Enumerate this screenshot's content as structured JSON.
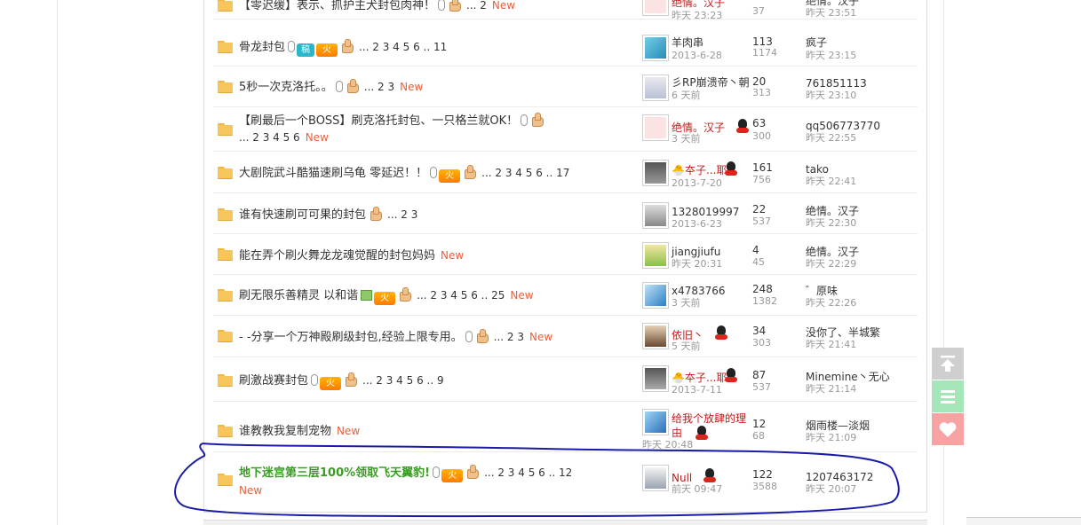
{
  "threads": [
    {
      "title": "【零迟缓】表示、抓护主犬封包肉神！",
      "pages": "... 2",
      "new": "New",
      "author": "绝情。汉子",
      "author_date": "昨天 23:23",
      "replies": "",
      "views": "37",
      "last_user": "绝情。汉子",
      "last_time": "昨天 23:51"
    },
    {
      "title": "骨龙封包",
      "pages": "... 2  3  4  5  6 .. 11",
      "new": "",
      "author": "羊肉串",
      "author_date": "2013-6-28",
      "replies": "113",
      "views": "1174",
      "last_user": "疯子",
      "last_time": "昨天 23:15"
    },
    {
      "title": "5秒一次克洛托。。",
      "pages": "... 2  3",
      "new": "New",
      "author": "彡RP崩溃帝丶朝",
      "author_date": "6 天前",
      "replies": "20",
      "views": "313",
      "last_user": "761851113",
      "last_time": "昨天 23:10"
    },
    {
      "title": "【刷最后一个BOSS】刷克洛托封包、一只格兰就OK！",
      "pages": "... 2  3  4  5  6",
      "new": "New",
      "author": "绝情。汉子",
      "author_date": "3 天前",
      "replies": "63",
      "views": "300",
      "last_user": "qq506773770",
      "last_time": "昨天 22:55"
    },
    {
      "title": "大剧院武斗酷猫速刷乌龟 零延迟！！",
      "pages": "... 2  3  4  5  6 .. 17",
      "new": "",
      "author": "🐣夲子...耶",
      "author_date": "2013-7-20",
      "replies": "161",
      "views": "756",
      "last_user": "tako",
      "last_time": "昨天 22:41"
    },
    {
      "title": "谁有快速刷可可果的封包",
      "pages": "... 2  3",
      "new": "",
      "author": "1328019997",
      "author_date": "2013-6-23",
      "replies": "22",
      "views": "537",
      "last_user": "绝情。汉子",
      "last_time": "昨天 22:30"
    },
    {
      "title": "能在弄个刷火舞龙龙魂觉醒的封包妈妈",
      "pages": "",
      "new": "New",
      "author": "jiangjiufu",
      "author_date": "昨天 20:31",
      "replies": "4",
      "views": "45",
      "last_user": "绝情。汉子",
      "last_time": "昨天 22:29"
    },
    {
      "title": "刷无限乐善精灵 以和谐",
      "pages": "... 2  3  4  5  6 .. 25",
      "new": "New",
      "author": "x4783766",
      "author_date": "3 天前",
      "replies": "248",
      "views": "1382",
      "last_user": "゛原味",
      "last_time": "昨天 22:26"
    },
    {
      "title": "- -分享一个万神殿刷级封包,经验上限专用。",
      "pages": "... 2  3",
      "new": "New",
      "author": "依旧丶",
      "author_date": "5 天前",
      "replies": "34",
      "views": "303",
      "last_user": "没你了、半城繁",
      "last_time": "昨天 21:41"
    },
    {
      "title": "刷激战赛封包",
      "pages": "... 2  3  4  5  6 .. 9",
      "new": "",
      "author": "🐣夲子...耶",
      "author_date": "2013-7-11",
      "replies": "87",
      "views": "537",
      "last_user": "Minemine丶无心",
      "last_time": "昨天 21:14"
    },
    {
      "title": "谁教教我复制宠物",
      "pages": "",
      "new": "New",
      "author": "给我个放肆的理由",
      "author_date": "昨天 20:48",
      "replies": "12",
      "views": "68",
      "last_user": "烟雨楼—淡烟",
      "last_time": "昨天 21:09"
    },
    {
      "title": "地下迷宫第三层100%领取飞天翼豹!",
      "pages": "... 2  3  4  5  6 .. 12",
      "new": "New",
      "author": "Null",
      "author_date": "前天 09:47",
      "replies": "122",
      "views": "3588",
      "last_user": "1207463172",
      "last_time": "昨天 20:07"
    }
  ],
  "badges": {
    "fire": "火",
    "jing": "稿"
  },
  "colors": {
    "accent_new": "#e8603c",
    "highlight_title": "#3a9d23",
    "circle": "#1a1aa8"
  },
  "side_buttons": [
    "back-to-top",
    "list",
    "favorite"
  ]
}
